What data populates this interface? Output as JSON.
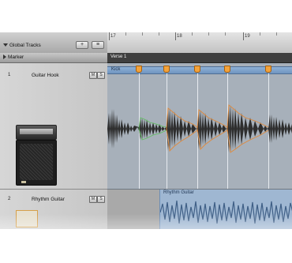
{
  "colors": {
    "region_blue": "#7fa3cc",
    "flex_marker": "#f3a23a",
    "waveform_dark": "#2e2e2e",
    "waveform_orange": "#e0893a",
    "waveform_green": "#5fbf5f"
  },
  "global_tracks": {
    "label": "Global Tracks",
    "add_button": "+",
    "config_button": "≡"
  },
  "ruler": {
    "bars": [
      "17",
      "18",
      "19"
    ]
  },
  "marker": {
    "label": "Marker",
    "verse_label": "Verse 1"
  },
  "tracks": [
    {
      "number": "1",
      "name": "Guitar Hook",
      "mute": "M",
      "solo": "S",
      "region_name": "Kick",
      "icon": "guitar-amp-icon"
    },
    {
      "number": "2",
      "name": "Rhythm Guitar",
      "mute": "M",
      "solo": "S",
      "region_name": "Rhythm Guitar",
      "icon": "guitar-amp-icon"
    }
  ]
}
